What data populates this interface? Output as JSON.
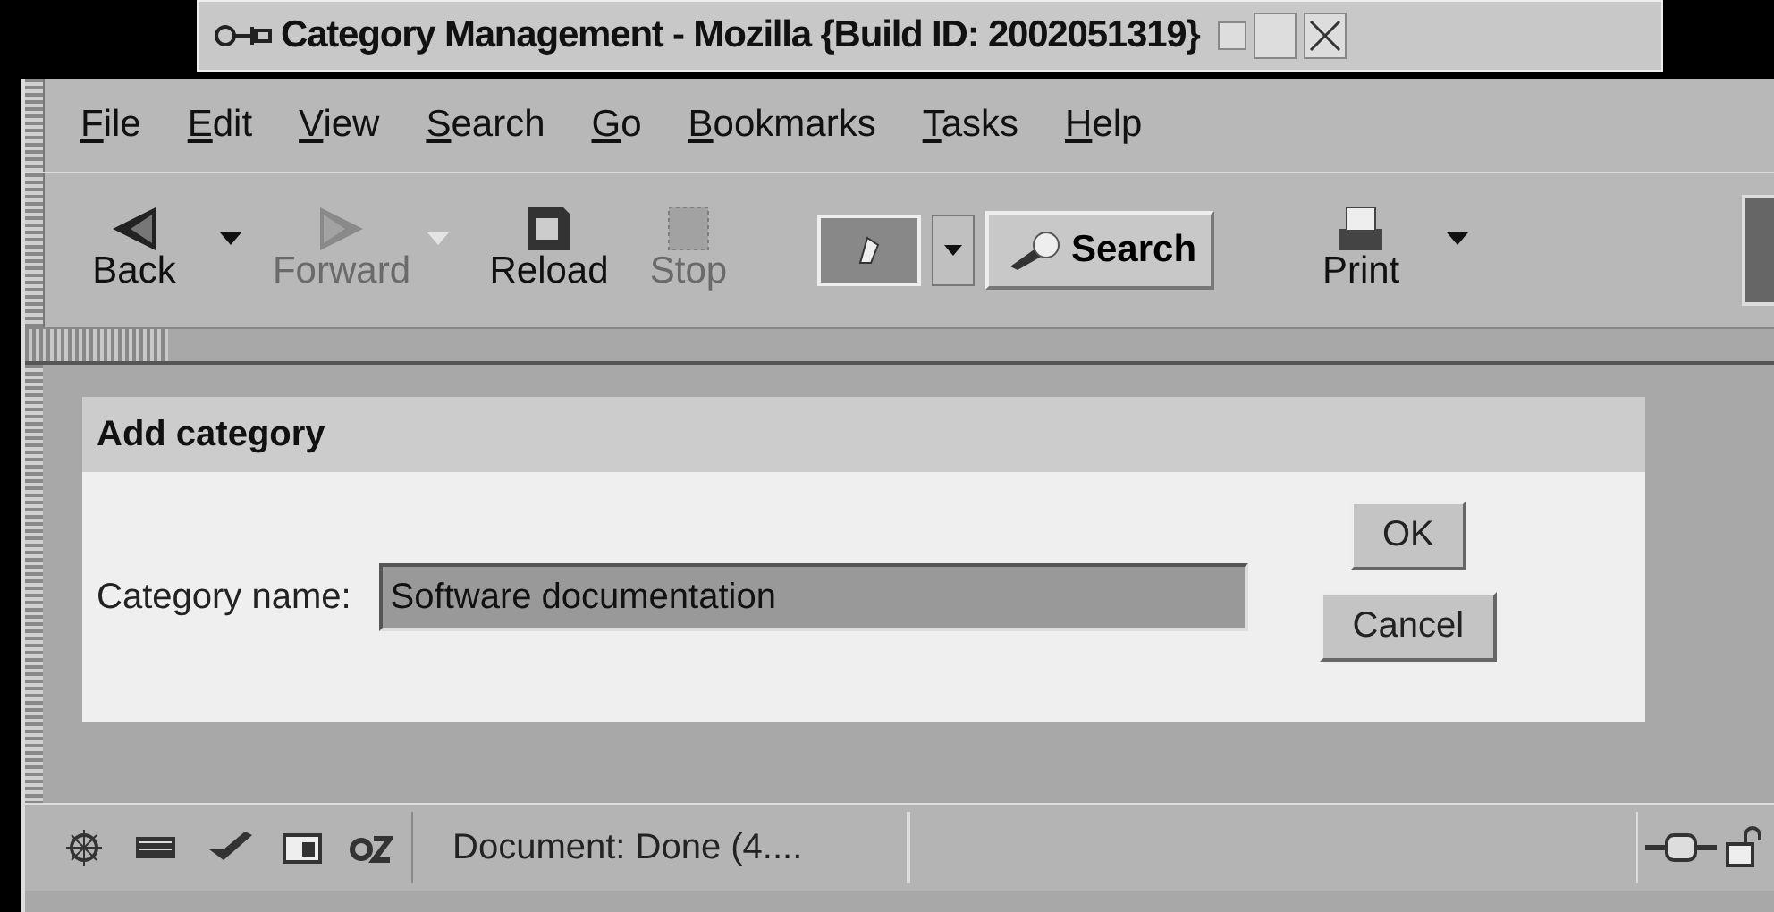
{
  "window": {
    "title": "Category Management - Mozilla {Build ID: 2002051319}"
  },
  "menu": [
    {
      "label": "File"
    },
    {
      "label": "Edit"
    },
    {
      "label": "View"
    },
    {
      "label": "Search"
    },
    {
      "label": "Go"
    },
    {
      "label": "Bookmarks"
    },
    {
      "label": "Tasks"
    },
    {
      "label": "Help"
    }
  ],
  "toolbar": [
    {
      "kind": "back",
      "label": "Back",
      "disabled": false
    },
    {
      "kind": "dropdown",
      "disabled": false
    },
    {
      "kind": "forward",
      "label": "Forward",
      "disabled": true
    },
    {
      "kind": "dropdown",
      "disabled": true
    },
    {
      "kind": "reload",
      "label": "Reload",
      "disabled": false
    },
    {
      "kind": "stop",
      "label": "Stop",
      "disabled": true
    },
    {
      "kind": "url"
    },
    {
      "kind": "search",
      "label": "Search"
    },
    {
      "kind": "print",
      "label": "Print",
      "disabled": false
    },
    {
      "kind": "dropdown",
      "disabled": false
    }
  ],
  "dialog": {
    "title": "Add category",
    "field_label": "Category name:",
    "field_value": "Software documentation",
    "buttons": [
      "OK",
      "Cancel"
    ]
  },
  "status_bar": {
    "text": "Document: Done (4...."
  }
}
